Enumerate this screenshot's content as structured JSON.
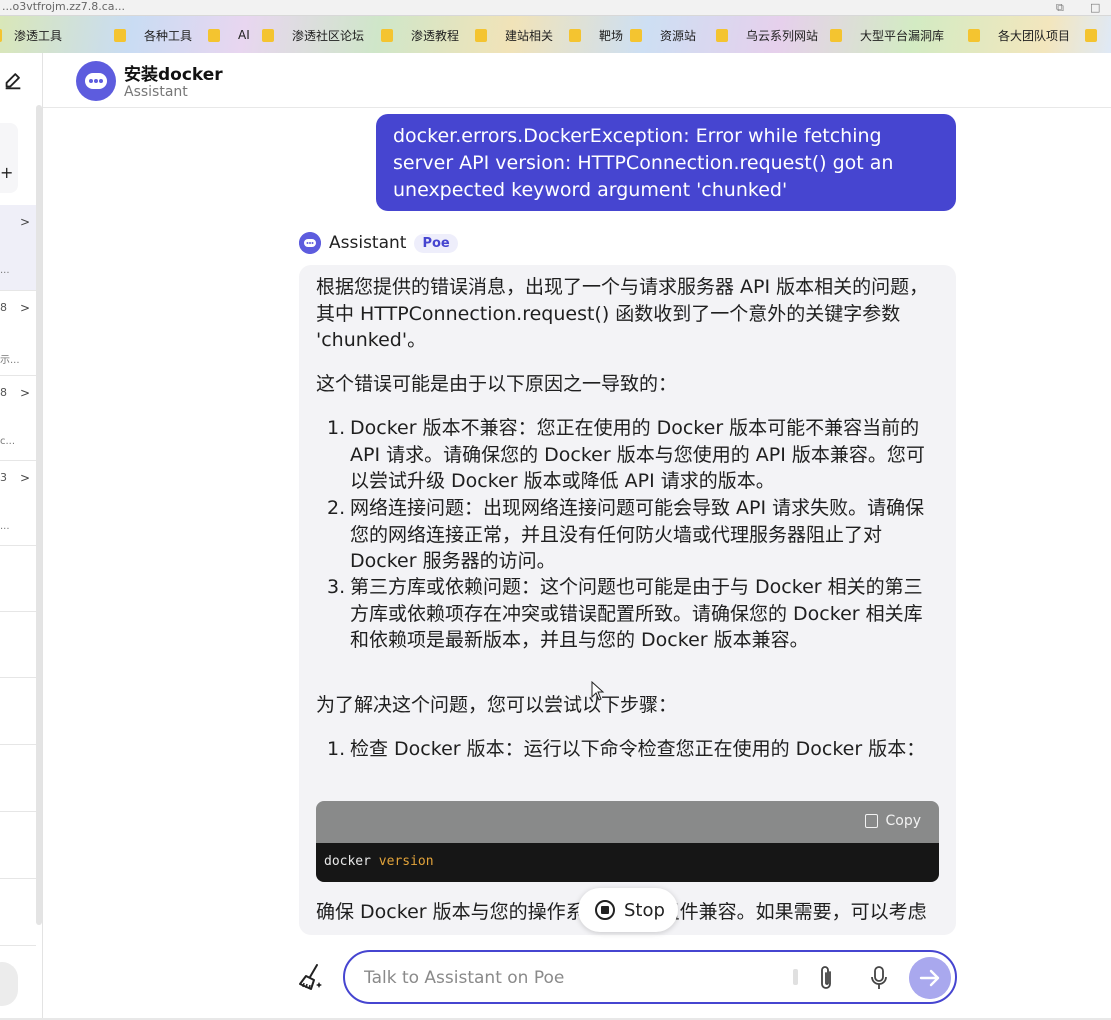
{
  "browser": {
    "url_fragment": "...o3vtfrojm.zz7.8.ca...",
    "bookmarks": [
      "渗透工具",
      "各种工具",
      "AI",
      "渗透社区论坛",
      "渗透教程",
      "建站相关",
      "靶场",
      "资源站",
      "乌云系列网站",
      "大型平台漏洞库",
      "各大团队项目"
    ]
  },
  "sidebar": {
    "rail_items": [
      {
        "num": "",
        "dots": "..."
      },
      {
        "num": "8",
        "dots": "示..."
      },
      {
        "num": "8",
        "dots": "c..."
      },
      {
        "num": "3",
        "dots": "..."
      }
    ]
  },
  "header": {
    "title": "安装docker",
    "subtitle": "Assistant"
  },
  "conversation": {
    "user_message": "docker.errors.DockerException: Error while fetching server API version: HTTPConnection.request() got an unexpected keyword argument 'chunked'",
    "assistant_name": "Assistant",
    "assistant_badge": "Poe",
    "para1": "根据您提供的错误消息，出现了一个与请求服务器 API 版本相关的问题，其中 HTTPConnection.request() 函数收到了一个意外的关键字参数 'chunked'。",
    "para2": "这个错误可能是由于以下原因之一导致的：",
    "causes": [
      {
        "n": "1.",
        "text": "Docker 版本不兼容：您正在使用的 Docker 版本可能不兼容当前的 API 请求。请确保您的 Docker 版本与您使用的 API 版本兼容。您可以尝试升级 Docker 版本或降低 API 请求的版本。"
      },
      {
        "n": "2.",
        "text": "网络连接问题：出现网络连接问题可能会导致 API 请求失败。请确保您的网络连接正常，并且没有任何防火墙或代理服务器阻止了对 Docker 服务器的访问。"
      },
      {
        "n": "3.",
        "text": "第三方库或依赖问题：这个问题也可能是由于与 Docker 相关的第三方库或依赖项存在冲突或错误配置所致。请确保您的 Docker 相关库和依赖项是最新版本，并且与您的 Docker 版本兼容。"
      }
    ],
    "para3": "为了解决这个问题，您可以尝试以下步骤：",
    "steps": [
      {
        "n": "1.",
        "text": "检查 Docker 版本：运行以下命令检查您正在使用的 Docker 版本："
      }
    ],
    "code": {
      "copy_label": "Copy",
      "cmd": "docker",
      "arg": "version"
    },
    "para4": "确保 Docker 版本与您的操作系统和其他组件兼容。如果需要，可以考虑"
  },
  "stop_button": {
    "label": "Stop"
  },
  "composer": {
    "placeholder": "Talk to Assistant on Poe"
  },
  "colors": {
    "accent": "#4645d0",
    "avatar": "#5d5cde",
    "send_disabled": "#a9a8ee",
    "bubble_bg": "#f3f3f6"
  }
}
